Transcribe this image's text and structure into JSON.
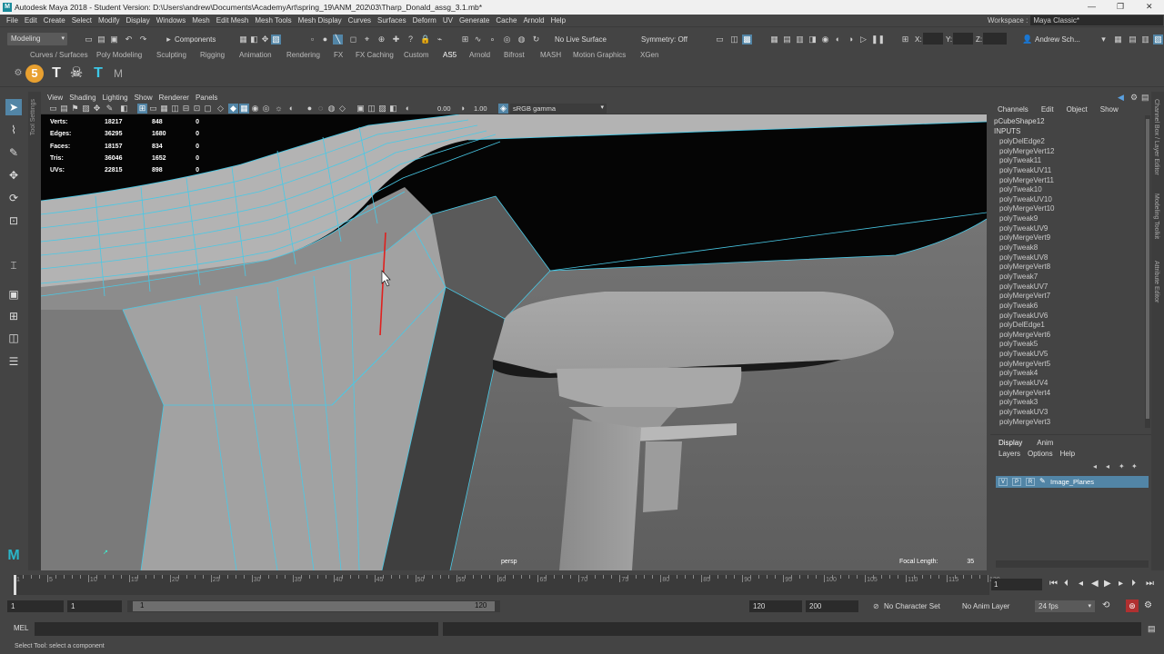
{
  "window": {
    "title": "Autodesk Maya 2018 - Student Version: D:\\Users\\andrew\\Documents\\AcademyArt\\spring_19\\ANM_202\\03\\Tharp_Donald_assg_3.1.mb*",
    "minimize": "—",
    "restore": "❐",
    "close": "✕"
  },
  "menubar": {
    "items": [
      "File",
      "Edit",
      "Create",
      "Select",
      "Modify",
      "Display",
      "Windows",
      "Mesh",
      "Edit Mesh",
      "Mesh Tools",
      "Mesh Display",
      "Curves",
      "Surfaces",
      "Deform",
      "UV",
      "Generate",
      "Cache",
      "Arnold",
      "Help"
    ],
    "workspace_label": "Workspace :",
    "workspace_value": "Maya Classic*"
  },
  "statusline": {
    "mode": "Modeling",
    "components": "Components",
    "live_surface": "No Live Surface",
    "symmetry": "Symmetry: Off",
    "x_label": "X:",
    "y_label": "Y:",
    "z_label": "Z:",
    "user": "Andrew Sch..."
  },
  "shelf": {
    "tabs": [
      "Curves / Surfaces",
      "Poly Modeling",
      "Sculpting",
      "Rigging",
      "Animation",
      "Rendering",
      "FX",
      "FX Caching",
      "Custom",
      "AS5",
      "Arnold",
      "Bifrost",
      "MASH",
      "Motion Graphics",
      "XGen"
    ],
    "active_tab": "AS5"
  },
  "toolbox": {
    "tool_settings_label": "Tool Settings"
  },
  "viewport": {
    "menus": [
      "View",
      "Shading",
      "Lighting",
      "Show",
      "Renderer",
      "Panels"
    ],
    "gamma_value": "0.00",
    "exposure_value": "1.00",
    "color_space": "sRGB gamma",
    "camera": "persp",
    "focal_label": "Focal Length:",
    "focal_value": "35",
    "hud": [
      {
        "label": "Verts:",
        "v1": "18217",
        "v2": "848",
        "v3": "0"
      },
      {
        "label": "Edges:",
        "v1": "36295",
        "v2": "1680",
        "v3": "0"
      },
      {
        "label": "Faces:",
        "v1": "18157",
        "v2": "834",
        "v3": "0"
      },
      {
        "label": "Tris:",
        "v1": "36046",
        "v2": "1652",
        "v3": "0"
      },
      {
        "label": "UVs:",
        "v1": "22815",
        "v2": "898",
        "v3": "0"
      }
    ]
  },
  "channelbox": {
    "menus": [
      "Channels",
      "Edit",
      "Object",
      "Show"
    ],
    "object": "pCubeShape12",
    "inputs_label": "INPUTS",
    "inputs": [
      "polyDelEdge2",
      "polyMergeVert12",
      "polyTweak11",
      "polyTweakUV11",
      "polyMergeVert11",
      "polyTweak10",
      "polyTweakUV10",
      "polyMergeVert10",
      "polyTweak9",
      "polyTweakUV9",
      "polyMergeVert9",
      "polyTweak8",
      "polyTweakUV8",
      "polyMergeVert8",
      "polyTweak7",
      "polyTweakUV7",
      "polyMergeVert7",
      "polyTweak6",
      "polyTweakUV6",
      "polyDelEdge1",
      "polyMergeVert6",
      "polyTweak5",
      "polyTweakUV5",
      "polyMergeVert5",
      "polyTweak4",
      "polyTweakUV4",
      "polyMergeVert4",
      "polyTweak3",
      "polyTweakUV3",
      "polyMergeVert3"
    ]
  },
  "layers": {
    "tabs": [
      "Display",
      "Anim"
    ],
    "menus": [
      "Layers",
      "Options",
      "Help"
    ],
    "layer_name": "Image_Planes",
    "v": "V",
    "p": "P",
    "r": "R"
  },
  "right_strip": {
    "labels": [
      "Channel Box / Layer Editor",
      "Modeling Toolkit",
      "Attribute Editor"
    ]
  },
  "timeslider": {
    "ticks": [
      "1",
      "5",
      "10",
      "15",
      "20",
      "25",
      "30",
      "35",
      "40",
      "45",
      "50",
      "55",
      "60",
      "65",
      "70",
      "75",
      "80",
      "85",
      "90",
      "95",
      "100",
      "105",
      "110",
      "115",
      "120"
    ],
    "current_frame": "1"
  },
  "rangeslider": {
    "start": "1",
    "playback_start": "1",
    "range_start_label": "1",
    "range_end_label": "120",
    "playback_end": "120",
    "end": "200",
    "character_set": "No Character Set",
    "anim_layer": "No Anim Layer",
    "fps": "24 fps"
  },
  "mel": {
    "label": "MEL"
  },
  "helpline": {
    "text": "Select Tool: select a component"
  }
}
